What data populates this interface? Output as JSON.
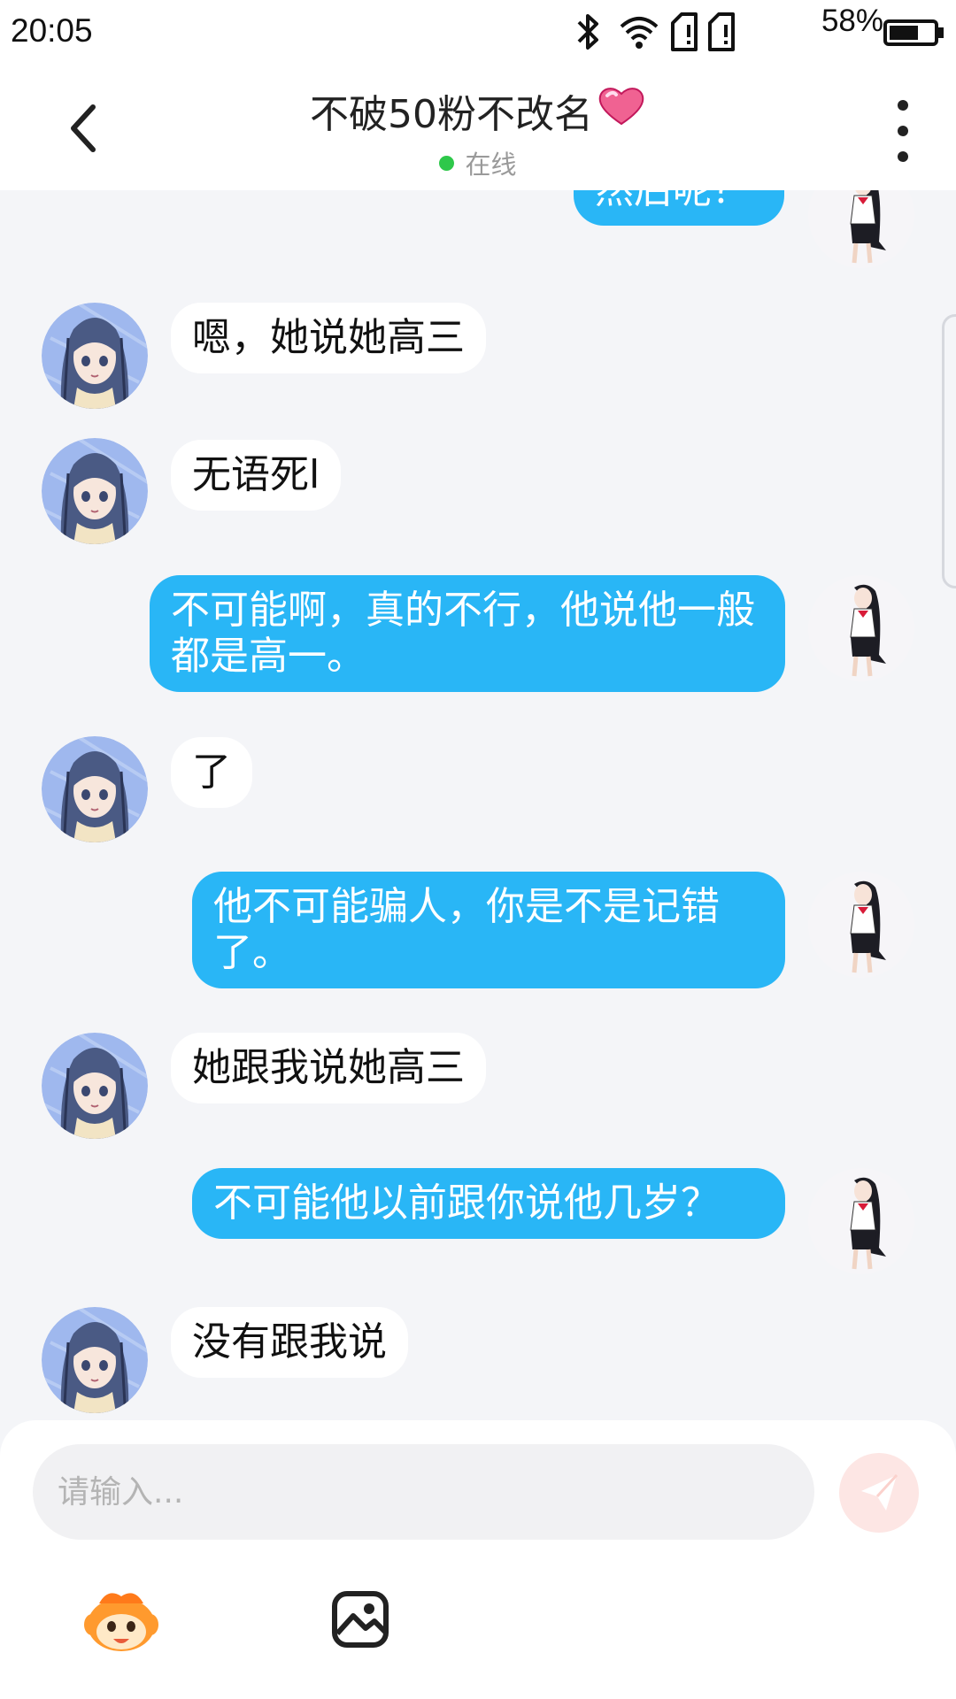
{
  "status_bar": {
    "time": "20:05",
    "battery_percent": "58%",
    "icons": [
      "bluetooth-icon",
      "wifi-icon",
      "sim1-icon",
      "sim2-icon",
      "battery-icon"
    ]
  },
  "header": {
    "title": "不破50粉不改名",
    "title_emoji": "heart-icon",
    "status": "在线",
    "status_color": "#2ec84a"
  },
  "messages": [
    {
      "side": "out",
      "text": "然后呢？"
    },
    {
      "side": "in",
      "text": "嗯，她说她高三"
    },
    {
      "side": "in",
      "text": "无语死l"
    },
    {
      "side": "out",
      "text": "不可能啊，真的不行，他说他一般都是高一。"
    },
    {
      "side": "in",
      "text": "了"
    },
    {
      "side": "out",
      "text": "他不可能骗人，你是不是记错了。"
    },
    {
      "side": "in",
      "text": "她跟我说她高三"
    },
    {
      "side": "out",
      "text": "不可能他以前跟你说他几岁？"
    },
    {
      "side": "in",
      "text": "没有跟我说"
    }
  ],
  "composer": {
    "placeholder": "请输入...",
    "tools": [
      "emoji-mascot-icon",
      "image-icon"
    ]
  },
  "colors": {
    "outgoing_bubble": "#29b6f6",
    "incoming_bubble": "#ffffff",
    "background": "#f4f5f8",
    "send_button": "#fde6e4"
  }
}
